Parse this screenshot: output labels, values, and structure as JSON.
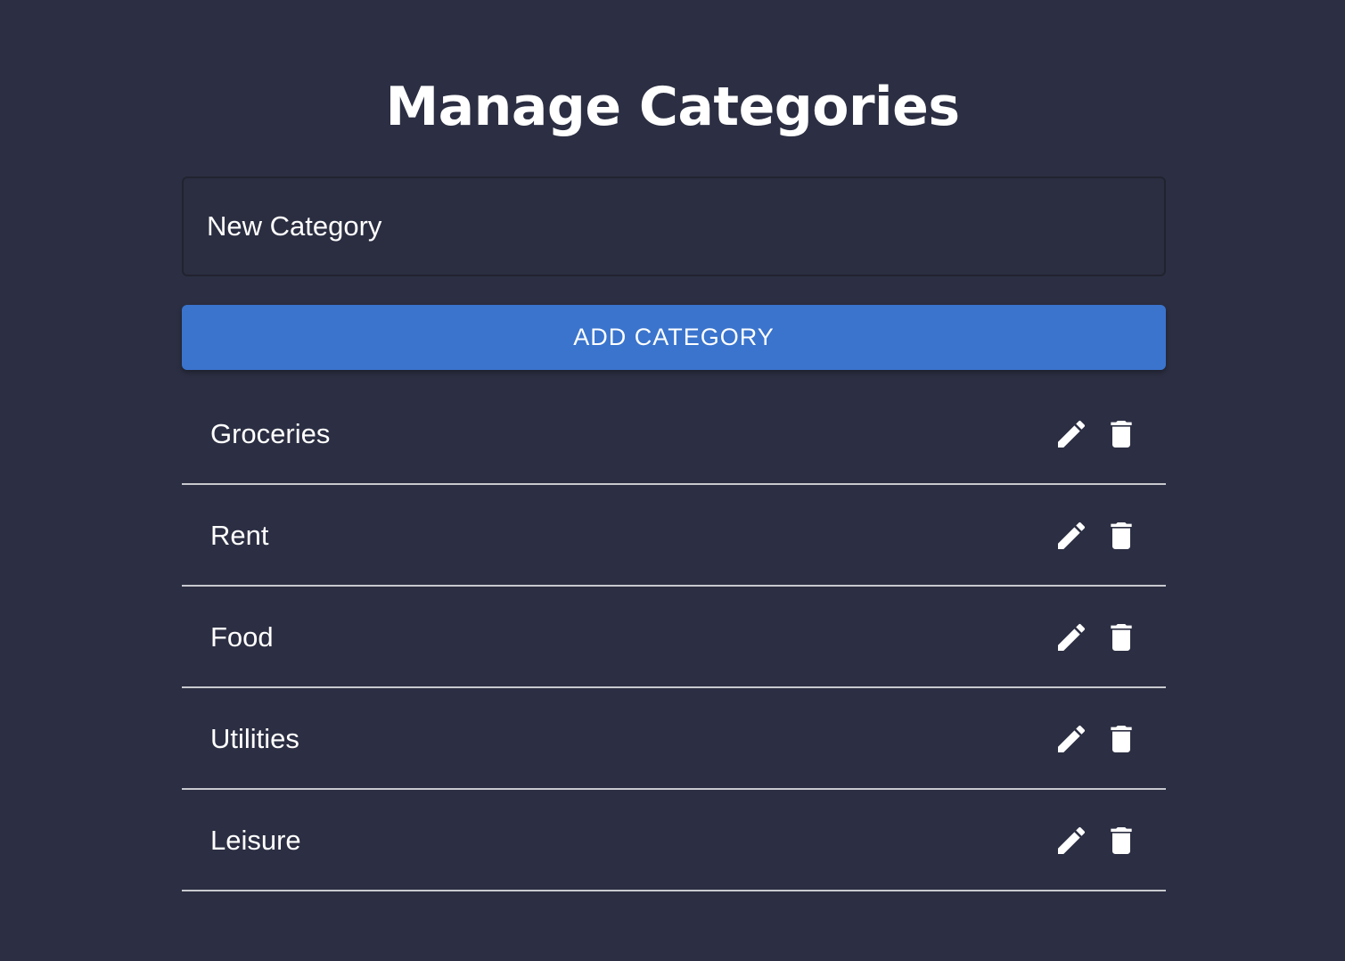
{
  "page": {
    "title": "Manage Categories"
  },
  "form": {
    "placeholder": "New Category",
    "value": "",
    "add_label": "ADD CATEGORY"
  },
  "categories": [
    {
      "name": "Groceries"
    },
    {
      "name": "Rent"
    },
    {
      "name": "Food"
    },
    {
      "name": "Utilities"
    },
    {
      "name": "Leisure"
    }
  ],
  "icons": {
    "edit": "pencil-icon",
    "delete": "trash-icon"
  },
  "colors": {
    "background": "#2c2f43",
    "accent": "#3a74cd",
    "divider": "#c8c9cf",
    "text": "#ffffff"
  }
}
